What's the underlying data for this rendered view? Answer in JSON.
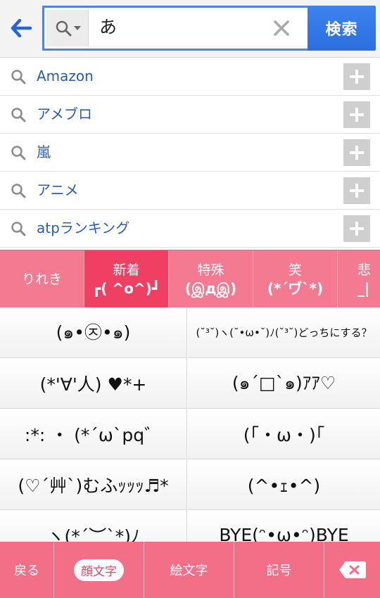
{
  "search": {
    "query": "あ",
    "submit_label": "検索"
  },
  "suggestions": [
    {
      "text": "Amazon"
    },
    {
      "text": "アメブロ"
    },
    {
      "text": "嵐"
    },
    {
      "text": "アニメ"
    },
    {
      "text": "atpランキング"
    }
  ],
  "tabs": [
    {
      "line1": "りれき",
      "line2": ""
    },
    {
      "line1": "新着",
      "line2": "┏( ^o^)┛"
    },
    {
      "line1": "特殊",
      "line2": "(இдஇ)"
    },
    {
      "line1": "笑",
      "line2": "(*´ヷ`*)"
    },
    {
      "line1": "悲",
      "line2": "_|"
    }
  ],
  "emoticons": [
    [
      "(๑•㉨•๑)",
      "(˘³˘)ヽ(˘•ω•˘)ﾉ(˘³˘)どっちにする？"
    ],
    [
      "(*'∀'人) ♥*+",
      "(๑´□`๑)ｱｱ♡"
    ],
    [
      ":*: ・ (*´ω`pq゛",
      "(｢・ω・)｢"
    ],
    [
      "(♡´艸`)むふｯｯｯ♬*",
      "(^•ｪ•^)"
    ],
    [
      "ヽ(*´︶`*)ﾉ",
      "BYE(ᵔ•ω•ᵔ)BYE"
    ]
  ],
  "bottombar": {
    "back_label": "戻る",
    "face_label": "顔文字",
    "picture_label": "絵文字",
    "symbol_label": "記号"
  },
  "colors": {
    "accent_blue": "#2b6fe0",
    "tab_pink": "#f37a90",
    "tab_active": "#ef3f63"
  }
}
